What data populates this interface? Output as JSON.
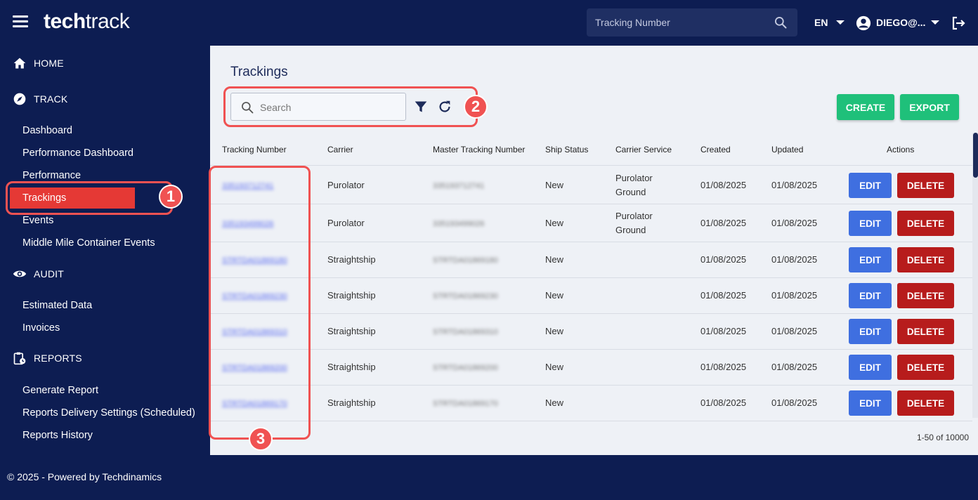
{
  "header": {
    "logo_bold": "tech",
    "logo_light": "track",
    "search_placeholder": "Tracking Number",
    "language": "EN",
    "user": "DIEGO@..."
  },
  "sidebar": {
    "sections": [
      {
        "label": "HOME",
        "icon": "home-icon"
      },
      {
        "label": "TRACK",
        "icon": "compass-icon"
      },
      {
        "label": "AUDIT",
        "icon": "eye-icon"
      },
      {
        "label": "REPORTS",
        "icon": "clipboard-clock-icon"
      }
    ],
    "track_items": [
      "Dashboard",
      "Performance Dashboard",
      "Performance",
      "Trackings",
      "Events",
      "Middle Mile Container Events"
    ],
    "audit_items": [
      "Estimated Data",
      "Invoices"
    ],
    "reports_items": [
      "Generate Report",
      "Reports Delivery Settings (Scheduled)",
      "Reports History"
    ],
    "active": "Trackings"
  },
  "annotations": [
    "1",
    "2",
    "3"
  ],
  "main": {
    "title": "Trackings",
    "search_placeholder": "Search",
    "create_label": "CREATE",
    "export_label": "EXPORT",
    "columns": [
      "Tracking Number",
      "Carrier",
      "Master Tracking Number",
      "Ship Status",
      "Carrier Service",
      "Created",
      "Updated",
      "Actions"
    ],
    "rows": [
      {
        "tracking": "335193712741",
        "carrier": "Purolator",
        "master": "335193712741",
        "status": "New",
        "service": [
          "Purolator",
          "Ground"
        ],
        "created": "01/08/2025",
        "updated": "01/08/2025"
      },
      {
        "tracking": "335193499026",
        "carrier": "Purolator",
        "master": "335193499026",
        "status": "New",
        "service": [
          "Purolator",
          "Ground"
        ],
        "created": "01/08/2025",
        "updated": "01/08/2025"
      },
      {
        "tracking": "STRTDA01869180",
        "carrier": "Straightship",
        "master": "STRTDA01869180",
        "status": "New",
        "service": [],
        "created": "01/08/2025",
        "updated": "01/08/2025"
      },
      {
        "tracking": "STRTDA01869230",
        "carrier": "Straightship",
        "master": "STRTDA01869230",
        "status": "New",
        "service": [],
        "created": "01/08/2025",
        "updated": "01/08/2025"
      },
      {
        "tracking": "STRTDA01869310",
        "carrier": "Straightship",
        "master": "STRTDA01869310",
        "status": "New",
        "service": [],
        "created": "01/08/2025",
        "updated": "01/08/2025"
      },
      {
        "tracking": "STRTDA01869200",
        "carrier": "Straightship",
        "master": "STRTDA01869200",
        "status": "New",
        "service": [],
        "created": "01/08/2025",
        "updated": "01/08/2025"
      },
      {
        "tracking": "STRTDA01869170",
        "carrier": "Straightship",
        "master": "STRTDA01869170",
        "status": "New",
        "service": [],
        "created": "01/08/2025",
        "updated": "01/08/2025"
      }
    ],
    "edit_label": "EDIT",
    "delete_label": "DELETE",
    "pagination": "1-50 of 10000"
  },
  "footer": "© 2025 - Powered by Techdinamics",
  "colors": {
    "navy": "#0d1d52",
    "active_red": "#e53935",
    "annotation_red": "#f05252",
    "green": "#1fc07a",
    "edit_blue": "#3f6fe0",
    "delete_red": "#b71c1c"
  }
}
